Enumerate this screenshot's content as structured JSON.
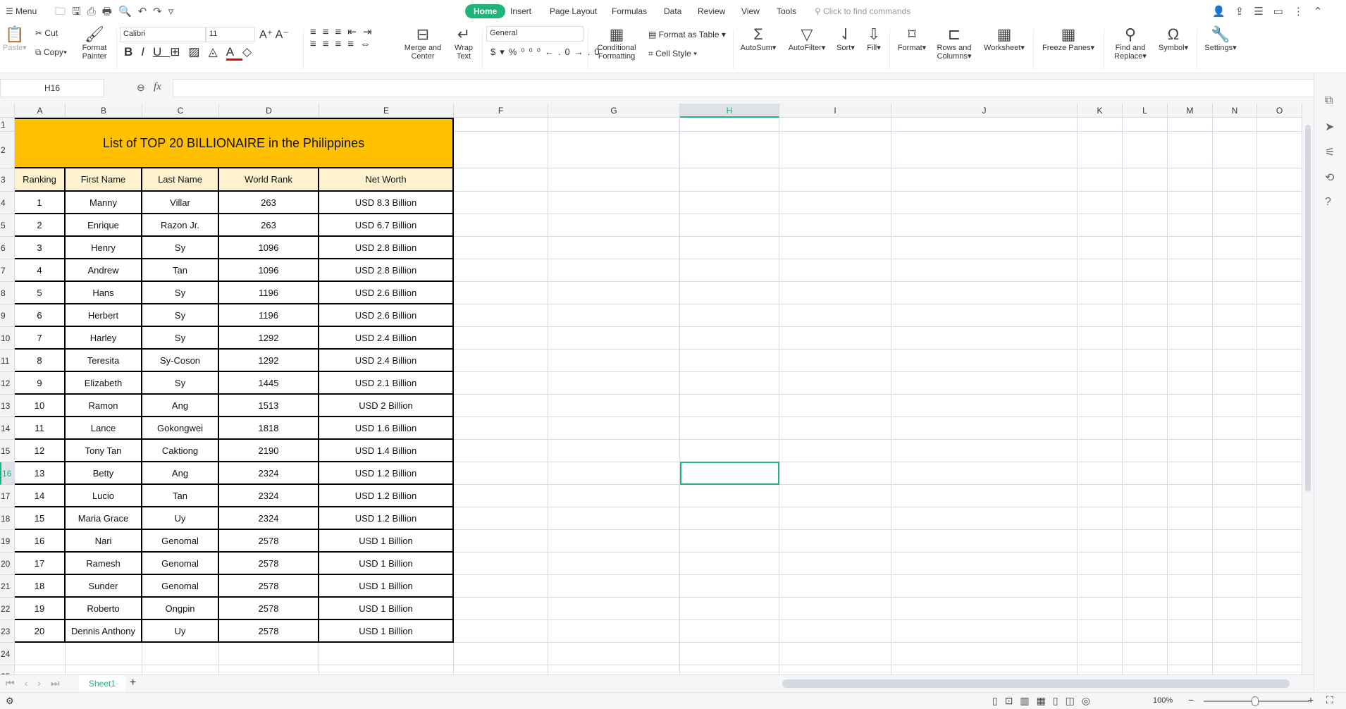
{
  "topbar": {
    "menu": "Menu",
    "tabs": [
      "Home",
      "Insert",
      "Page Layout",
      "Formulas",
      "Data",
      "Review",
      "View",
      "Tools"
    ],
    "search_placeholder": "Click to find commands"
  },
  "ribbon": {
    "paste": "Paste",
    "cut": "Cut",
    "copy": "Copy",
    "format_painter": "Format Painter",
    "font": "Calibri",
    "size": "11",
    "merge": "Merge and Center",
    "wrap": "Wrap Text",
    "number_format": "General",
    "conditional": "Conditional Formatting",
    "format_table": "Format as Table",
    "cell_style": "Cell Style",
    "autosum": "AutoSum",
    "autofilter": "AutoFilter",
    "sort": "Sort",
    "fill": "Fill",
    "format": "Format",
    "rows_cols": "Rows and Columns",
    "worksheet": "Worksheet",
    "freeze": "Freeze Panes",
    "find": "Find and Replace",
    "symbol": "Symbol",
    "settings": "Settings"
  },
  "formula_bar": {
    "name_box": "H16",
    "fx": "fx",
    "value": ""
  },
  "columns": [
    "A",
    "B",
    "C",
    "D",
    "E",
    "F",
    "G",
    "H",
    "I",
    "J",
    "K",
    "L",
    "M",
    "N",
    "O"
  ],
  "selected_cell": "H16",
  "sheet": {
    "title": "List of TOP 20 BILLIONAIRE in the Philippines",
    "headers": [
      "Ranking",
      "First Name",
      "Last Name",
      "World Rank",
      "Net Worth"
    ],
    "rows": [
      [
        "1",
        "Manny",
        "Villar",
        "263",
        "USD 8.3 Billion"
      ],
      [
        "2",
        "Enrique",
        "Razon Jr.",
        "263",
        "USD 6.7 Billion"
      ],
      [
        "3",
        "Henry",
        "Sy",
        "1096",
        "USD 2.8 Billion"
      ],
      [
        "4",
        "Andrew",
        "Tan",
        "1096",
        "USD 2.8 Billion"
      ],
      [
        "5",
        "Hans",
        "Sy",
        "1196",
        "USD 2.6 Billion"
      ],
      [
        "6",
        "Herbert",
        "Sy",
        "1196",
        "USD 2.6 Billion"
      ],
      [
        "7",
        "Harley",
        "Sy",
        "1292",
        "USD 2.4 Billion"
      ],
      [
        "8",
        "Teresita",
        "Sy-Coson",
        "1292",
        "USD 2.4 Billion"
      ],
      [
        "9",
        "Elizabeth",
        "Sy",
        "1445",
        "USD 2.1 Billion"
      ],
      [
        "10",
        "Ramon",
        "Ang",
        "1513",
        "USD 2 Billion"
      ],
      [
        "11",
        "Lance",
        "Gokongwei",
        "1818",
        "USD 1.6 Billion"
      ],
      [
        "12",
        "Tony Tan",
        "Caktiong",
        "2190",
        "USD 1.4 Billion"
      ],
      [
        "13",
        "Betty",
        "Ang",
        "2324",
        "USD 1.2 Billion"
      ],
      [
        "14",
        "Lucio",
        "Tan",
        "2324",
        "USD 1.2 Billion"
      ],
      [
        "15",
        "Maria Grace",
        "Uy",
        "2324",
        "USD 1.2 Billion"
      ],
      [
        "16",
        "Nari",
        "Genomal",
        "2578",
        "USD 1 Billion"
      ],
      [
        "17",
        "Ramesh",
        "Genomal",
        "2578",
        "USD 1 Billion"
      ],
      [
        "18",
        "Sunder",
        "Genomal",
        "2578",
        "USD 1 Billion"
      ],
      [
        "19",
        "Roberto",
        "Ongpin",
        "2578",
        "USD 1 Billion"
      ],
      [
        "20",
        "Dennis Anthony",
        "Uy",
        "2578",
        "USD 1 Billion"
      ]
    ]
  },
  "sheet_tabs": [
    "Sheet1"
  ],
  "status": {
    "zoom": "100%"
  },
  "colors": {
    "accent": "#1fb57a",
    "title_fill": "#ffc000",
    "header_fill": "#fff2cc"
  }
}
